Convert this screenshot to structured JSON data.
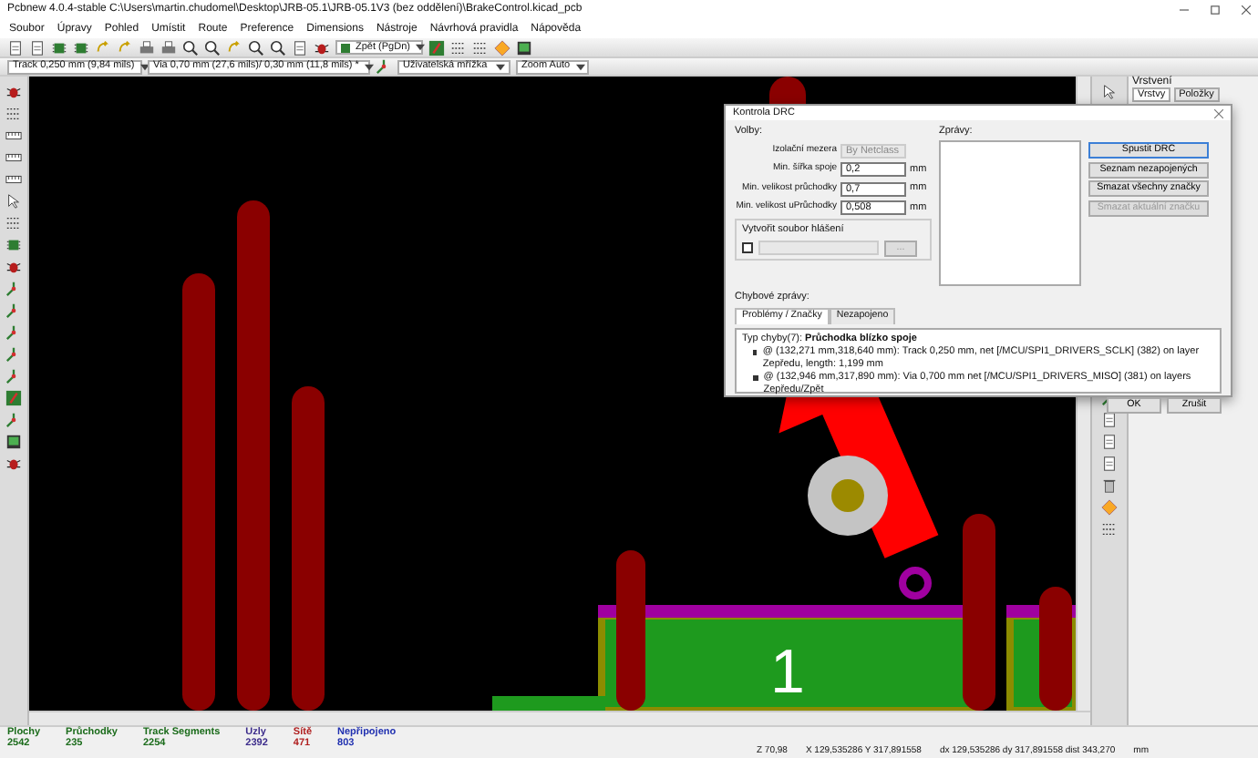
{
  "window": {
    "title": "Pcbnew 4.0.4-stable C:\\Users\\martin.chudomel\\Desktop\\JRB-05.1\\JRB-05.1V3 (bez oddělení)\\BrakeControl.kicad_pcb"
  },
  "menu": [
    "Soubor",
    "Úpravy",
    "Pohled",
    "Umístit",
    "Route",
    "Preference",
    "Dimensions",
    "Nástroje",
    "Návrhová pravidla",
    "Nápověda"
  ],
  "layer_select": {
    "value": "Zpět (PgDn)"
  },
  "options_bar": {
    "track": "Track 0,250 mm (9,84 mils)",
    "via": "Via 0,70 mm (27,6 mils)/ 0,30 mm (11,8 mils) *",
    "grid": "Uživatelská mřížka",
    "zoom": "Zoom Auto"
  },
  "layers_panel": {
    "title": "Vrstvení",
    "tabs": [
      {
        "label": "Vrstvy",
        "selected": true
      },
      {
        "label": "Položky",
        "selected": false
      }
    ]
  },
  "board": {
    "silkscreen_text": "1"
  },
  "drc_dialog": {
    "title": "Kontrola DRC",
    "options_label": "Volby:",
    "fields": [
      {
        "label": "Izolační mezera",
        "value": "By Netclass",
        "disabled": true
      },
      {
        "label": "Min. šířka spoje",
        "value": "0,2",
        "unit": "mm",
        "disabled": false
      },
      {
        "label": "Min. velikost průchodky",
        "value": "0,7",
        "unit": "mm",
        "disabled": false
      },
      {
        "label": "Min. velikost uPrůchodky",
        "value": "0,508",
        "unit": "mm",
        "disabled": false
      }
    ],
    "report": {
      "label": "Vytvořit soubor hlášení",
      "checked": false,
      "browse": "..."
    },
    "messages_label": "Zprávy:",
    "buttons": [
      {
        "label": "Spustit DRC",
        "disabled": false
      },
      {
        "label": "Seznam nezapojených",
        "disabled": false
      },
      {
        "label": "Smazat všechny značky",
        "disabled": false
      },
      {
        "label": "Smazat aktuální značku",
        "disabled": true
      }
    ],
    "errors_label": "Chybové zprávy:",
    "tabs": [
      {
        "label": "Problémy / Značky",
        "selected": true
      },
      {
        "label": "Nezapojeno",
        "selected": false
      }
    ],
    "error_type": "Typ chyby(7): **Průchodka blízko spoje**",
    "error_items": [
      "@ (132,271 mm,318,640 mm): Track 0,250 mm, net [/MCU/SPI1_DRIVERS_SCLK] (382) on layer Zepředu, length: 1,199 mm",
      "@ (132,946 mm,317,890 mm): Via 0,700 mm net [/MCU/SPI1_DRIVERS_MISO] (381) on layers Zepředu/Zpět"
    ],
    "footer_buttons": [
      "OK",
      "Zrušit"
    ]
  },
  "stats": [
    {
      "label": "Plochy",
      "value": "2542",
      "color": "#1a6b1a"
    },
    {
      "label": "Průchodky",
      "value": "235",
      "color": "#1a6b1a"
    },
    {
      "label": "Track Segments",
      "value": "2254",
      "color": "#1a6b1a"
    },
    {
      "label": "Uzly",
      "value": "2392",
      "color": "#3a2a8a"
    },
    {
      "label": "Sítě",
      "value": "471",
      "color": "#b02020"
    },
    {
      "label": "Nepřipojeno",
      "value": "803",
      "color": "#2030b0"
    }
  ],
  "status": {
    "zoom": "Z 70,98",
    "position": "X 129,535286 Y 317,891558",
    "delta": "dx 129,535286 dy 317,891558 dist 343,270",
    "units": "mm"
  }
}
